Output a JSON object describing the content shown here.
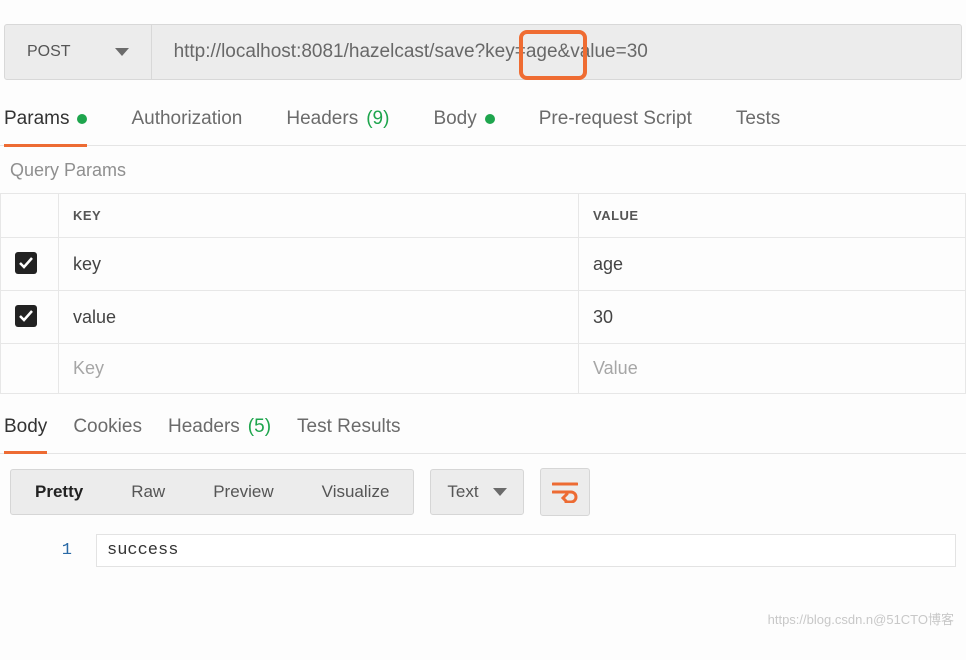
{
  "request": {
    "method": "POST",
    "url": "http://localhost:8081/hazelcast/save?key=age&value=30"
  },
  "req_tabs": {
    "params": "Params",
    "auth": "Authorization",
    "headers": "Headers",
    "headers_count": "(9)",
    "body": "Body",
    "prerequest": "Pre-request Script",
    "tests": "Tests"
  },
  "query_section_title": "Query Params",
  "table": {
    "header_key": "KEY",
    "header_value": "VALUE",
    "rows": [
      {
        "key": "key",
        "value": "age"
      },
      {
        "key": "value",
        "value": "30"
      }
    ],
    "placeholder_key": "Key",
    "placeholder_value": "Value"
  },
  "resp_tabs": {
    "body": "Body",
    "cookies": "Cookies",
    "headers": "Headers",
    "headers_count": "(5)",
    "test_results": "Test Results"
  },
  "view_modes": {
    "pretty": "Pretty",
    "raw": "Raw",
    "preview": "Preview",
    "visualize": "Visualize"
  },
  "lang_select": "Text",
  "response": {
    "line_no": "1",
    "content": "success"
  },
  "watermark": "https://blog.csdn.n@51CTO博客"
}
